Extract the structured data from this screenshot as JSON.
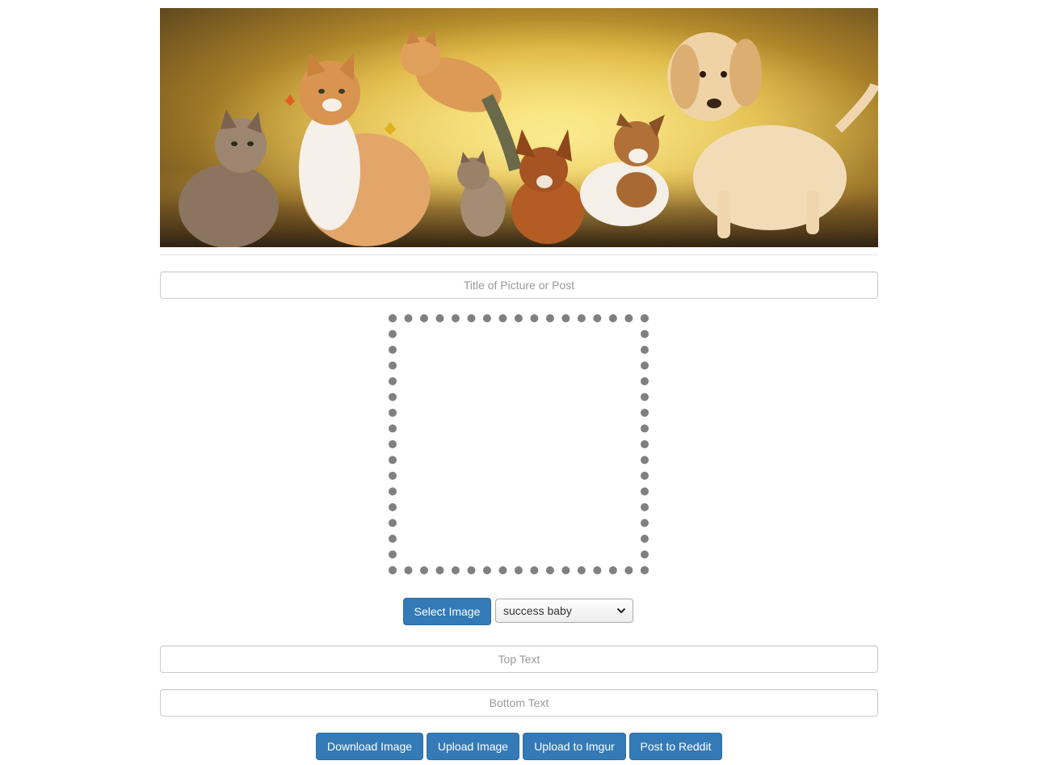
{
  "banner": {
    "alt_icon": "cats-and-dogs-banner"
  },
  "form": {
    "title_placeholder": "Title of Picture or Post",
    "top_text_placeholder": "Top Text",
    "bottom_text_placeholder": "Bottom Text"
  },
  "controls": {
    "select_image_label": "Select Image",
    "template_selected": "success baby"
  },
  "actions": {
    "download_label": "Download Image",
    "upload_label": "Upload Image",
    "imgur_label": "Upload to Imgur",
    "reddit_label": "Post to Reddit"
  },
  "colors": {
    "primary": "#337ab7",
    "dropzone_border": "#808080"
  }
}
